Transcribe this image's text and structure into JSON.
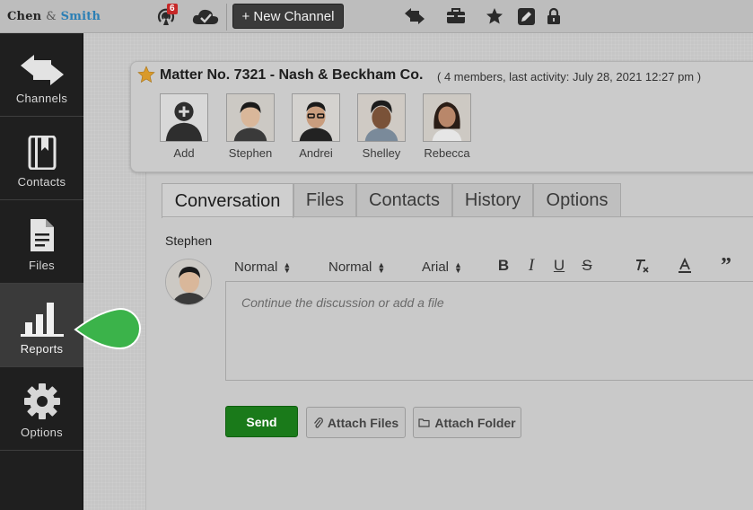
{
  "app": {
    "logo_left": "Chen",
    "logo_amp": "&",
    "logo_right": "Smith"
  },
  "topbar": {
    "notification_count": "6",
    "new_channel_label": "+ New Channel"
  },
  "sidebar": {
    "items": [
      {
        "label": "Channels",
        "icon": "swap-arrows-icon"
      },
      {
        "label": "Contacts",
        "icon": "address-book-icon"
      },
      {
        "label": "Files",
        "icon": "document-icon"
      },
      {
        "label": "Reports",
        "icon": "bar-chart-icon"
      },
      {
        "label": "Options",
        "icon": "gear-icon"
      }
    ],
    "active": "Reports"
  },
  "matter": {
    "title": "Matter No. 7321 - Nash & Beckham Co.",
    "meta": "( 4 members, last activity: July 28, 2021 12:27 pm )",
    "members": [
      {
        "name": "Add"
      },
      {
        "name": "Stephen"
      },
      {
        "name": "Andrei"
      },
      {
        "name": "Shelley"
      },
      {
        "name": "Rebecca"
      }
    ]
  },
  "tabs": [
    "Conversation",
    "Files",
    "Contacts",
    "History",
    "Options"
  ],
  "active_tab": "Conversation",
  "composer": {
    "author": "Stephen",
    "heading_select": "Normal",
    "size_select": "Normal",
    "font_select": "Arial",
    "placeholder": "Continue the discussion or add a file",
    "send_label": "Send",
    "attach_files_label": "Attach Files",
    "attach_folder_label": "Attach Folder"
  },
  "colors": {
    "send_green": "#1a7a1a",
    "marker_green": "#3bb34a",
    "star": "#d99a2b",
    "badge_red": "#c62828"
  }
}
